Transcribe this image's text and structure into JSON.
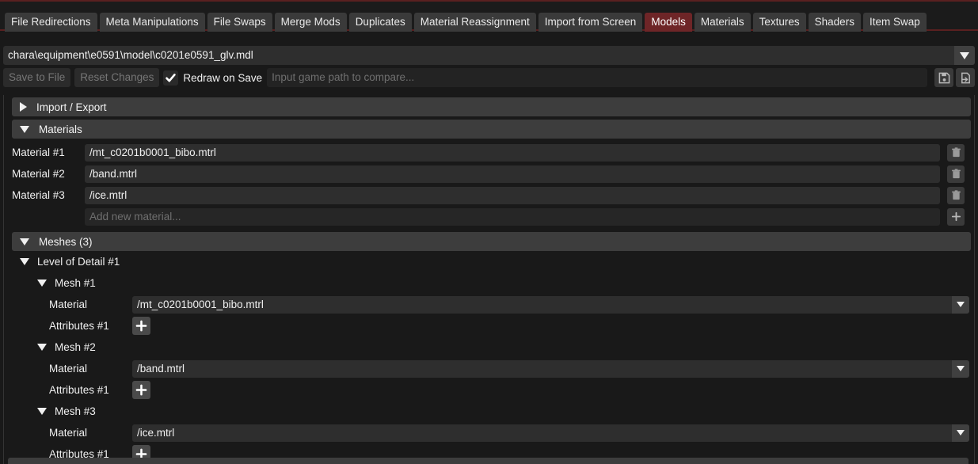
{
  "tabs": [
    {
      "label": "File Redirections",
      "active": false
    },
    {
      "label": "Meta Manipulations",
      "active": false
    },
    {
      "label": "File Swaps",
      "active": false
    },
    {
      "label": "Merge Mods",
      "active": false
    },
    {
      "label": "Duplicates",
      "active": false
    },
    {
      "label": "Material Reassignment",
      "active": false
    },
    {
      "label": "Import from Screen",
      "active": false
    },
    {
      "label": "Models",
      "active": true
    },
    {
      "label": "Materials",
      "active": false
    },
    {
      "label": "Textures",
      "active": false
    },
    {
      "label": "Shaders",
      "active": false
    },
    {
      "label": "Item Swap",
      "active": false
    }
  ],
  "path_bar": {
    "value": "chara\\equipment\\e0591\\model\\c0201e0591_glv.mdl",
    "dropdown_icon": "chevron-down-icon"
  },
  "toolbar": {
    "save_label": "Save to File",
    "reset_label": "Reset Changes",
    "redraw_label": "Redraw on Save",
    "redraw_checked": true,
    "compare_placeholder": "Input game path to compare...",
    "save_icon": "floppy-disk-icon",
    "import_icon": "file-import-icon"
  },
  "sections": {
    "import_export": {
      "label": "Import / Export",
      "expanded": false
    },
    "materials": {
      "label": "Materials",
      "expanded": true
    },
    "meshes": {
      "label": "Meshes (3)",
      "expanded": true
    }
  },
  "materials": {
    "rows": [
      {
        "label": "Material #1",
        "value": "/mt_c0201b0001_bibo.mtrl",
        "delete_icon": "trash-icon"
      },
      {
        "label": "Material #2",
        "value": "/band.mtrl",
        "delete_icon": "trash-icon"
      },
      {
        "label": "Material #3",
        "value": "/ice.mtrl",
        "delete_icon": "trash-icon"
      }
    ],
    "add_placeholder": "Add new material...",
    "add_icon": "plus-icon"
  },
  "meshes": {
    "lod_label": "Level of Detail #1",
    "lod_expanded": true,
    "material_row_label": "Material",
    "attributes_row_label": "Attributes #1",
    "attributes_add_icon": "plus-icon",
    "material_dropdown_icon": "chevron-down-icon",
    "items": [
      {
        "label": "Mesh #1",
        "expanded": true,
        "material": "/mt_c0201b0001_bibo.mtrl"
      },
      {
        "label": "Mesh #2",
        "expanded": true,
        "material": "/band.mtrl"
      },
      {
        "label": "Mesh #3",
        "expanded": true,
        "material": "/ice.mtrl"
      }
    ]
  },
  "colors": {
    "accent_red": "#6e2527",
    "border_red": "#5a2020",
    "background": "#191919",
    "panel_header": "#3d3d3d",
    "input_bg": "#2e2e2e"
  }
}
